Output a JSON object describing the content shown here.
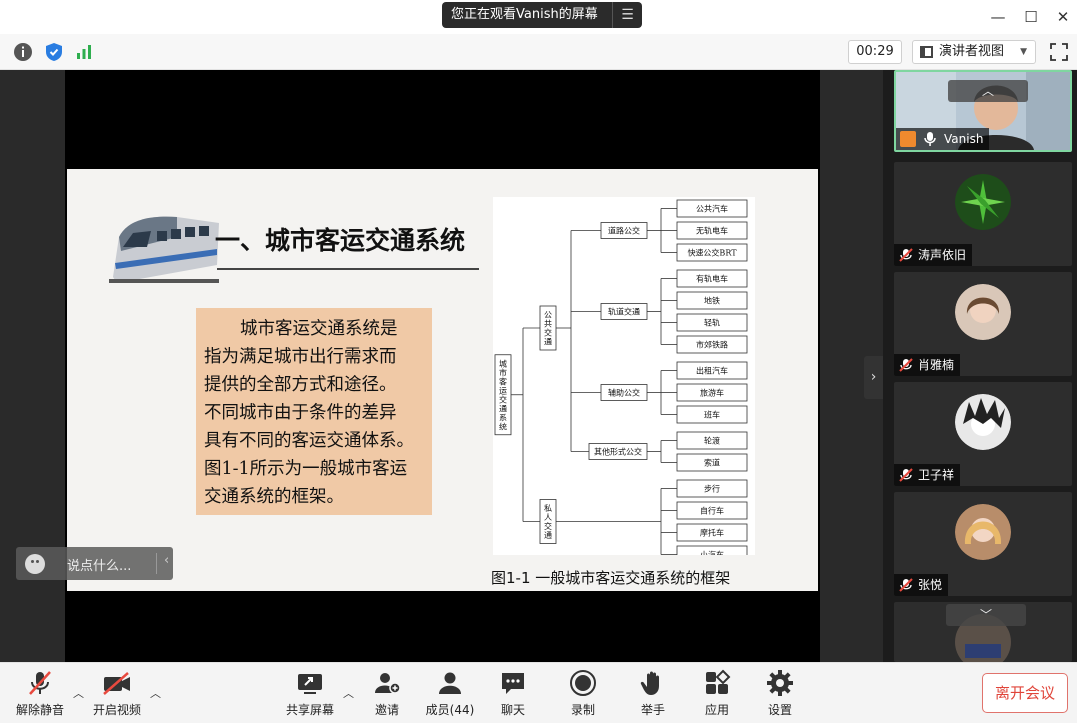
{
  "titlebar": {
    "share_notice": "您正在观看Vanish的屏幕",
    "menu_icon": "menu-icon",
    "minimize_icon": "minimize-icon",
    "maximize_icon": "maximize-icon",
    "close_icon": "close-icon"
  },
  "infobar": {
    "timer": "00:29",
    "view_mode": "演讲者视图",
    "icons": [
      "info-icon",
      "shield-icon",
      "signal-icon",
      "fullscreen-icon"
    ]
  },
  "slide": {
    "title": "一、城市客运交通系统",
    "body_lines": [
      "城市客运交通系统是",
      "指为满足城市出行需求而",
      "提供的全部方式和途径。",
      "不同城市由于条件的差异",
      "具有不同的客运交通体系。",
      "图1-1所示为一般城市客运",
      "交通系统的框架。"
    ],
    "caption": "图1-1  一般城市客运交通系统的框架",
    "diagram": {
      "root": "城市客运交通系统",
      "groups": [
        {
          "label": "公共交通",
          "subgroups": [
            {
              "label": "道路公交",
              "items": [
                "公共汽车",
                "无轨电车",
                "快速公交BRT"
              ]
            },
            {
              "label": "轨道交通",
              "items": [
                "有轨电车",
                "地铁",
                "轻轨",
                "市郊铁路"
              ]
            },
            {
              "label": "辅助公交",
              "items": [
                "出租汽车",
                "旅游车",
                "班车"
              ]
            },
            {
              "label": "其他形式公交",
              "items": [
                "轮渡",
                "索道"
              ]
            }
          ]
        },
        {
          "label": "私人交通",
          "items": [
            "步行",
            "自行车",
            "摩托车",
            "小汽车"
          ]
        }
      ]
    }
  },
  "chat": {
    "placeholder": "说点什么..."
  },
  "participants": [
    {
      "name": "Vanish",
      "type": "video",
      "muted": false
    },
    {
      "name": "涛声依旧",
      "type": "avatar",
      "muted": true
    },
    {
      "name": "肖雅楠",
      "type": "avatar",
      "muted": true
    },
    {
      "name": "卫子祥",
      "type": "avatar",
      "muted": true
    },
    {
      "name": "张悦",
      "type": "avatar",
      "muted": true
    }
  ],
  "toolbar": {
    "mute": "解除静音",
    "video": "开启视频",
    "share": "共享屏幕",
    "invite": "邀请",
    "members": "成员(44)",
    "chat": "聊天",
    "record": "录制",
    "raise_hand": "举手",
    "apps": "应用",
    "settings": "设置",
    "leave": "离开会议"
  },
  "colors": {
    "accent_green": "#7fd6a0",
    "leave_red": "#e0453a",
    "slide_box": "#f0c9a6"
  }
}
